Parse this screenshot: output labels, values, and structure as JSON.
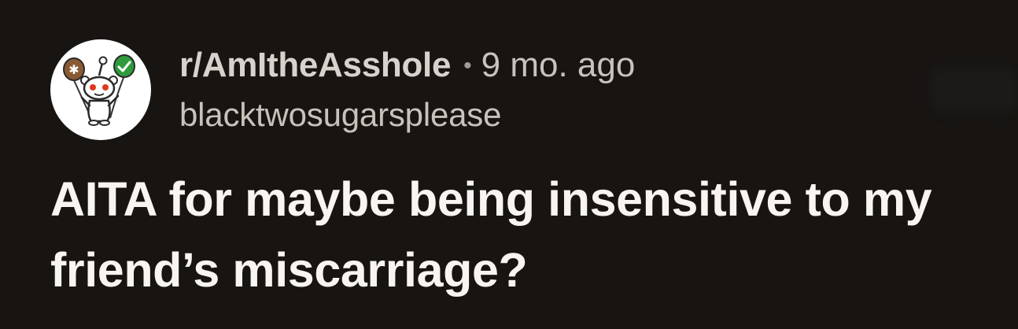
{
  "post": {
    "subreddit": "r/AmItheAsshole",
    "separator": "•",
    "time_ago": "9 mo. ago",
    "username": "blacktwosugarsplease",
    "title": "AITA for maybe being insensitive to my friend’s miscarriage?"
  },
  "icons": {
    "avatar": "snoo-holding-balloons-icon"
  },
  "colors": {
    "background": "#171412",
    "title": "#f7f4f1",
    "meta_text": "#c9c2bb",
    "balloon_brown": "#8a5a33",
    "balloon_green": "#2f9b3c"
  }
}
